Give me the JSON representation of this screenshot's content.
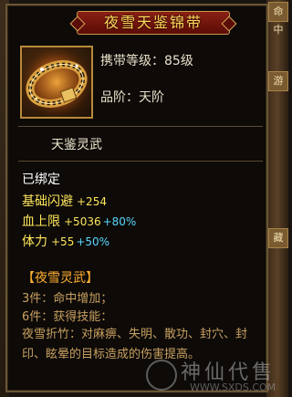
{
  "side": {
    "top_right": "命中",
    "mid_right_1": "游",
    "mid_right_2": "藏"
  },
  "tooltip": {
    "title": "夜雪天鉴锦带",
    "level": "携带等级：85级",
    "grade": "品阶：天阶",
    "art_name": "天鉴灵武",
    "bound": "已绑定",
    "stats": [
      {
        "label": "基础闪避",
        "value": "+254",
        "pct": ""
      },
      {
        "label": "血上限",
        "value": "+5036",
        "pct": "+80%"
      },
      {
        "label": "体力",
        "value": "+55",
        "pct": "+50%"
      }
    ],
    "set_title": "【夜雪灵武】",
    "set_3": "3件：命中增加；",
    "set_6": "6件：获得技能：",
    "set_desc": "夜雪折竹：对麻痹、失明、散功、封穴、封印、眩晕的目标造成的伤害提高。"
  },
  "watermark": {
    "text": "神仙代售",
    "url": "WWW.SXDS.COM"
  },
  "icon": {
    "name": "belt-icon"
  }
}
